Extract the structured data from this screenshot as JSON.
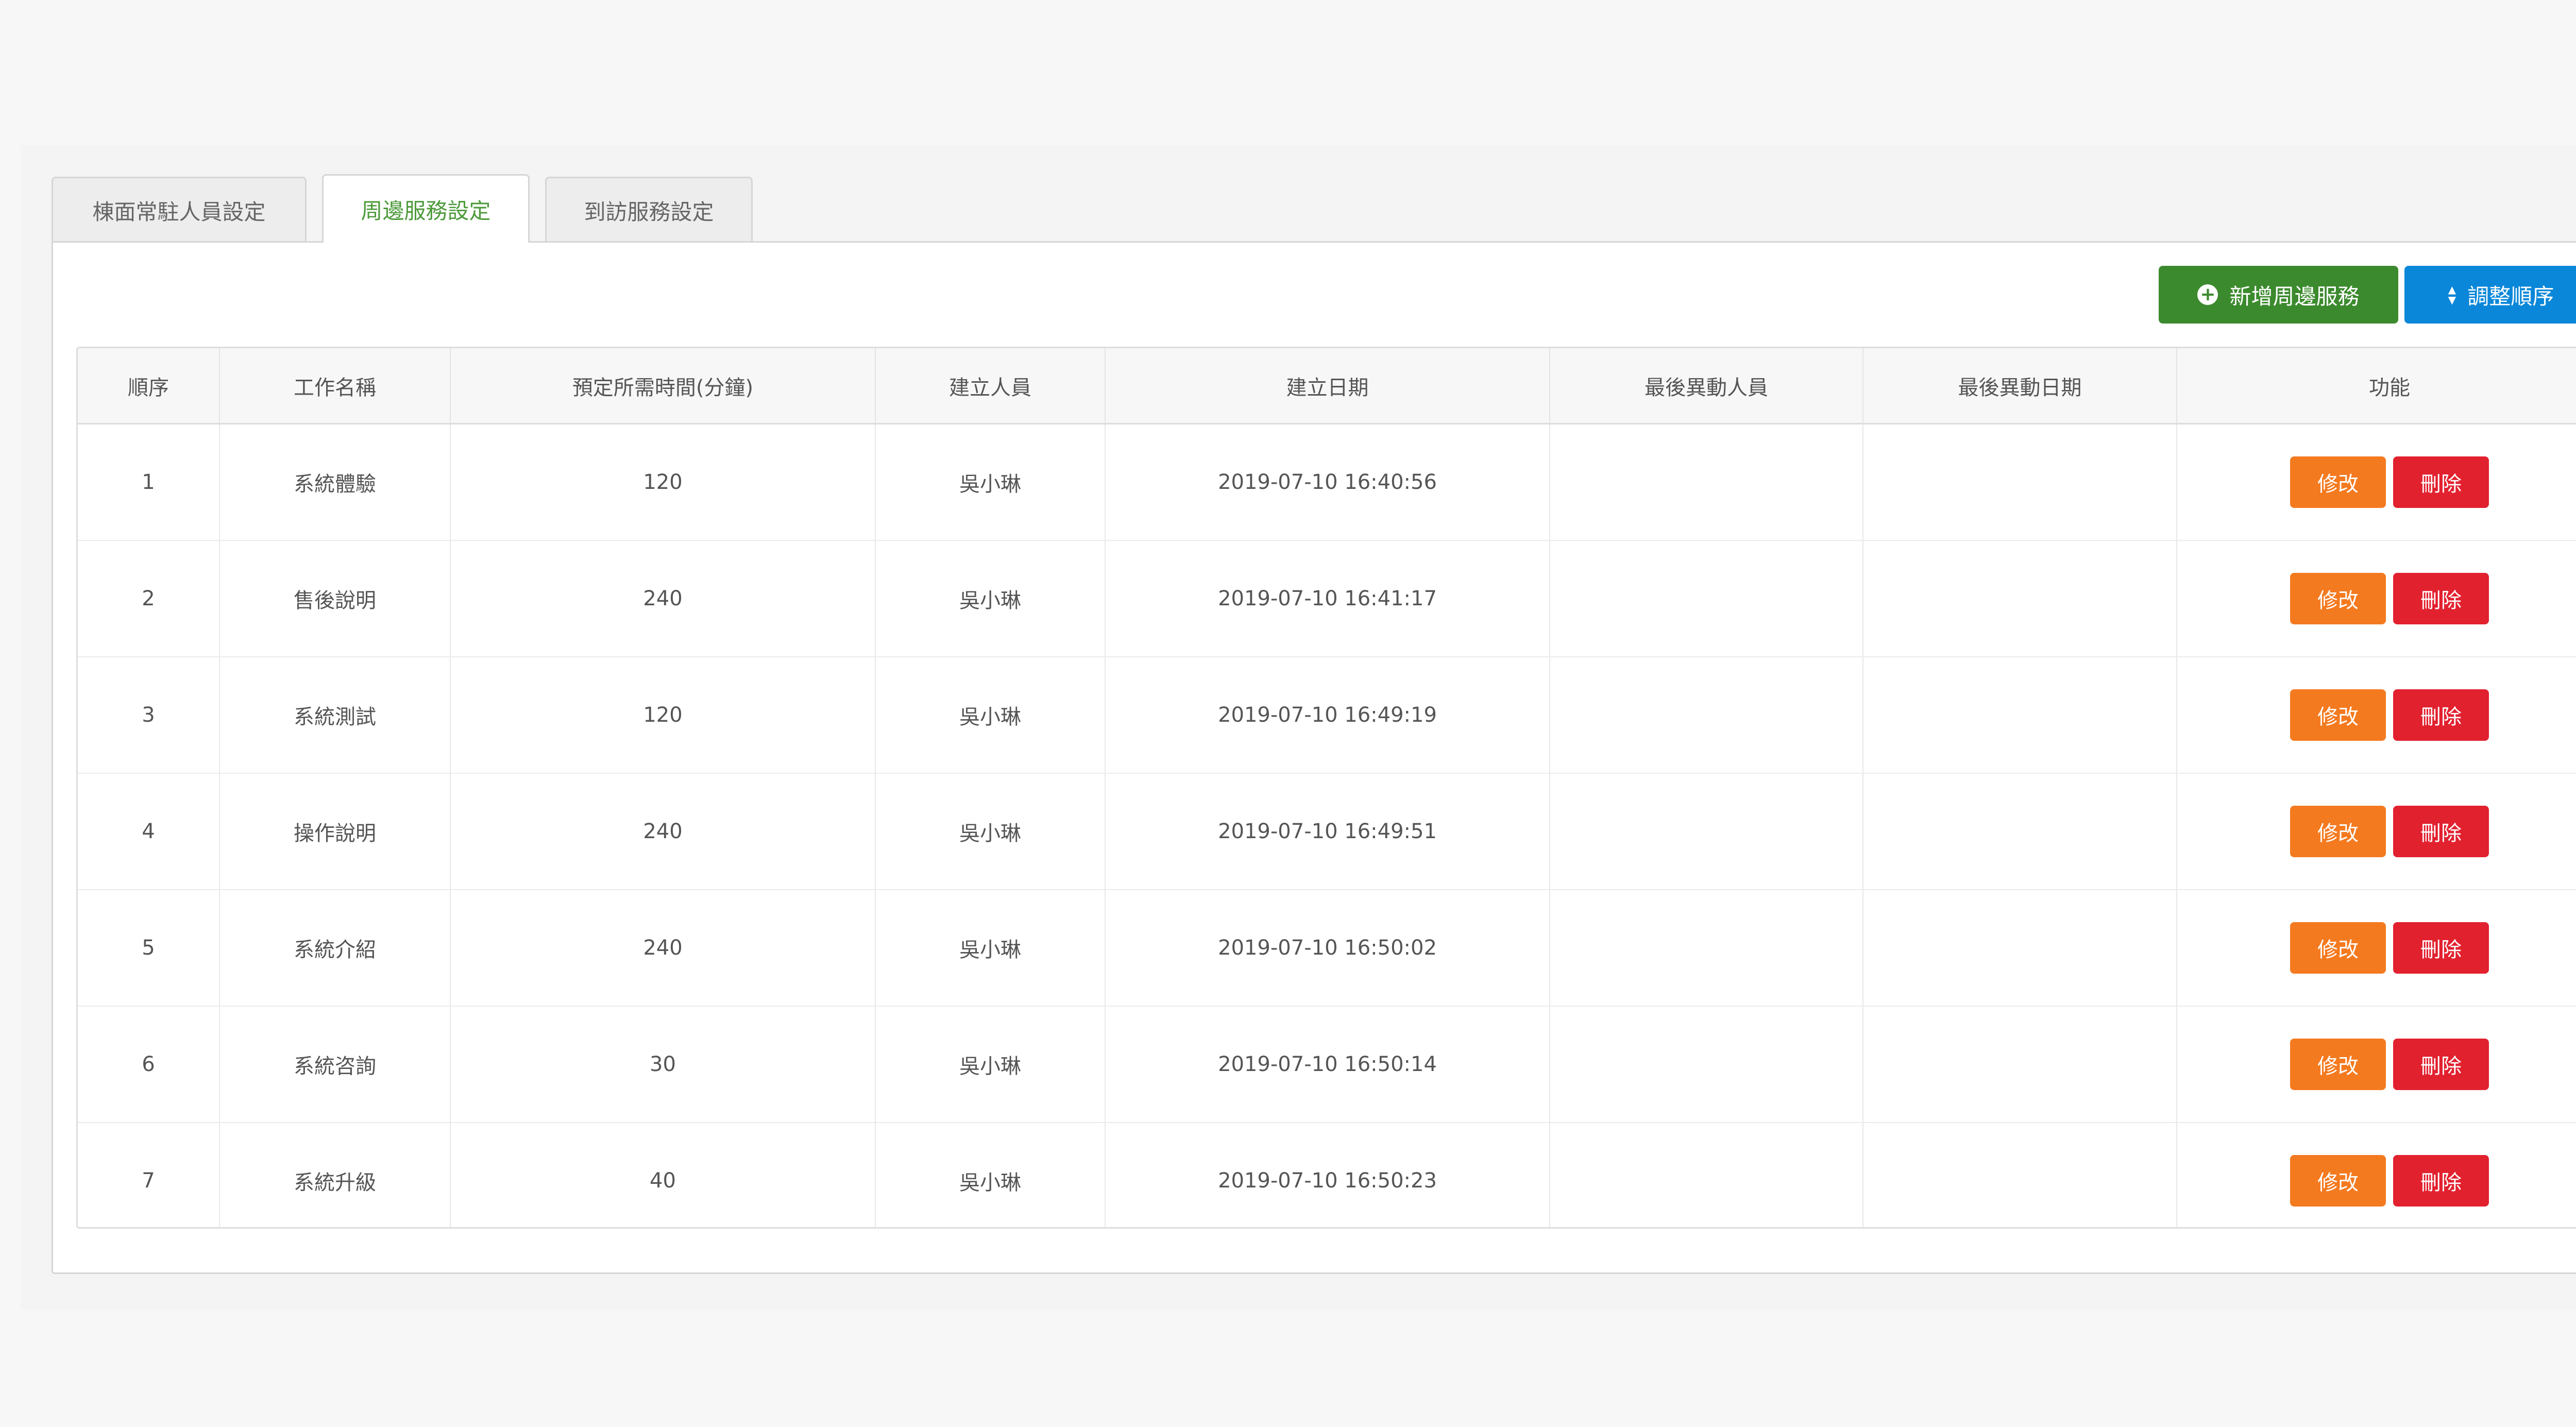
{
  "tabs": [
    {
      "label": "棟面常駐人員設定",
      "active": false
    },
    {
      "label": "周邊服務設定",
      "active": true
    },
    {
      "label": "到訪服務設定",
      "active": false
    }
  ],
  "actions": {
    "add_label": "新增周邊服務",
    "add_icon": "plus-circle-icon",
    "sort_label": "調整順序",
    "sort_icon": "sort-icon"
  },
  "table": {
    "columns": [
      "順序",
      "工作名稱",
      "預定所需時間(分鐘)",
      "建立人員",
      "建立日期",
      "最後異動人員",
      "最後異動日期",
      "功能"
    ],
    "edit_label": "修改",
    "delete_label": "刪除",
    "rows": [
      {
        "order": "1",
        "name": "系統體驗",
        "minutes": "120",
        "creator": "吳小琳",
        "created": "2019-07-10 16:40:56",
        "modifier": "",
        "modified": ""
      },
      {
        "order": "2",
        "name": "售後說明",
        "minutes": "240",
        "creator": "吳小琳",
        "created": "2019-07-10 16:41:17",
        "modifier": "",
        "modified": ""
      },
      {
        "order": "3",
        "name": "系統測試",
        "minutes": "120",
        "creator": "吳小琳",
        "created": "2019-07-10 16:49:19",
        "modifier": "",
        "modified": ""
      },
      {
        "order": "4",
        "name": "操作說明",
        "minutes": "240",
        "creator": "吳小琳",
        "created": "2019-07-10 16:49:51",
        "modifier": "",
        "modified": ""
      },
      {
        "order": "5",
        "name": "系統介紹",
        "minutes": "240",
        "creator": "吳小琳",
        "created": "2019-07-10 16:50:02",
        "modifier": "",
        "modified": ""
      },
      {
        "order": "6",
        "name": "系統咨詢",
        "minutes": "30",
        "creator": "吳小琳",
        "created": "2019-07-10 16:50:14",
        "modifier": "",
        "modified": ""
      },
      {
        "order": "7",
        "name": "系統升級",
        "minutes": "40",
        "creator": "吳小琳",
        "created": "2019-07-10 16:50:23",
        "modifier": "",
        "modified": ""
      }
    ]
  },
  "colors": {
    "accent_green": "#3c8a2e",
    "accent_blue": "#0a87d9",
    "edit_orange": "#f47a20",
    "delete_red": "#e2212f"
  }
}
